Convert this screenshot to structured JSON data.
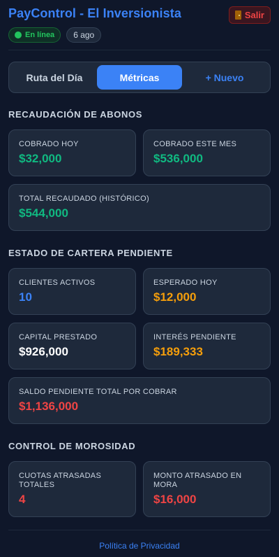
{
  "header": {
    "title": "PayControl - El Inversionista",
    "logout_label": "Salir",
    "status_badge": "En línea",
    "time_badge": "6 ago"
  },
  "tabs": [
    {
      "label": "Ruta del Día",
      "active": false
    },
    {
      "label": "Métricas",
      "active": true
    },
    {
      "label": "+ Nuevo",
      "active": false
    }
  ],
  "sections": {
    "collection": {
      "title": "RECAUDACIÓN DE ABONOS",
      "cobrado_hoy": {
        "label": "COBRADO HOY",
        "value": "$32,000"
      },
      "cobrado_mes": {
        "label": "COBRADO ESTE MES",
        "value": "$536,000"
      },
      "total_recaudado": {
        "label": "TOTAL RECAUDADO (HISTÓRICO)",
        "value": "$544,000"
      }
    },
    "portfolio": {
      "title": "ESTADO DE CARTERA PENDIENTE",
      "clientes_activos": {
        "label": "CLIENTES ACTIVOS",
        "value": "10"
      },
      "esperado_hoy": {
        "label": "ESPERADO HOY",
        "value": "$12,000"
      },
      "capital_prestado": {
        "label": "CAPITAL PRESTADO",
        "value": "$926,000"
      },
      "interes_pendiente": {
        "label": "INTERÉS PENDIENTE",
        "value": "$189,333"
      },
      "saldo_pendiente": {
        "label": "SALDO PENDIENTE TOTAL POR COBRAR",
        "value": "$1,136,000"
      }
    },
    "delinquency": {
      "title": "CONTROL DE MOROSIDAD",
      "cuotas_atrasadas": {
        "label": "CUOTAS ATRASADAS TOTALES",
        "value": "4"
      },
      "monto_atrasado": {
        "label": "MONTO ATRASADO EN MORA",
        "value": "$16,000"
      }
    }
  },
  "footer": {
    "privacy_link": "Política de Privacidad"
  },
  "colors": {
    "background": "#0f172a",
    "card": "#1e293b",
    "accent_blue": "#3b82f6",
    "green": "#10b981",
    "orange": "#f59e0b",
    "red": "#ef4444"
  }
}
